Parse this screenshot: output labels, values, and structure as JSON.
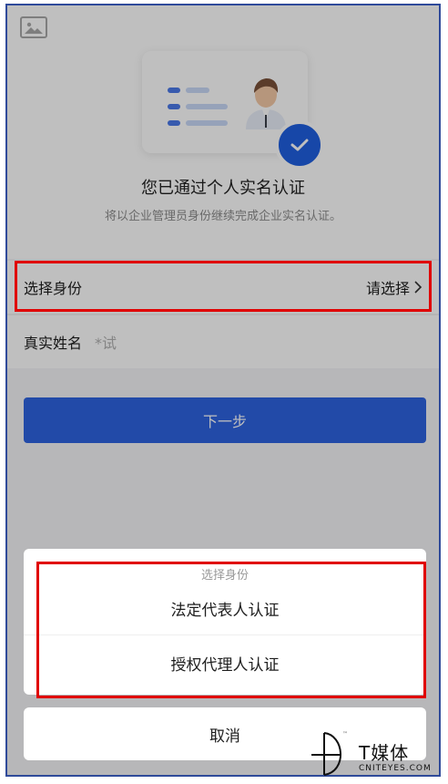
{
  "header": {
    "title": "您已通过个人实名认证",
    "subtitle": "将以企业管理员身份继续完成企业实名认证。"
  },
  "form": {
    "identity_label": "选择身份",
    "identity_value": "请选择",
    "name_label": "真实姓名",
    "name_value": "*试"
  },
  "actions": {
    "next_label": "下一步"
  },
  "action_sheet": {
    "title": "选择身份",
    "options": [
      "法定代表人认证",
      "授权代理人认证"
    ],
    "cancel_label": "取消"
  },
  "watermark": {
    "brand": "T媒体",
    "site": "CNITEYES.COM",
    "tm": "™"
  },
  "colors": {
    "primary": "#2e63e0",
    "highlight": "#e00000",
    "frame": "#2f4a9a"
  },
  "icons": [
    "image-placeholder-icon",
    "id-card-illustration",
    "check-icon",
    "chevron-right-icon",
    "watermark-logo-icon"
  ]
}
